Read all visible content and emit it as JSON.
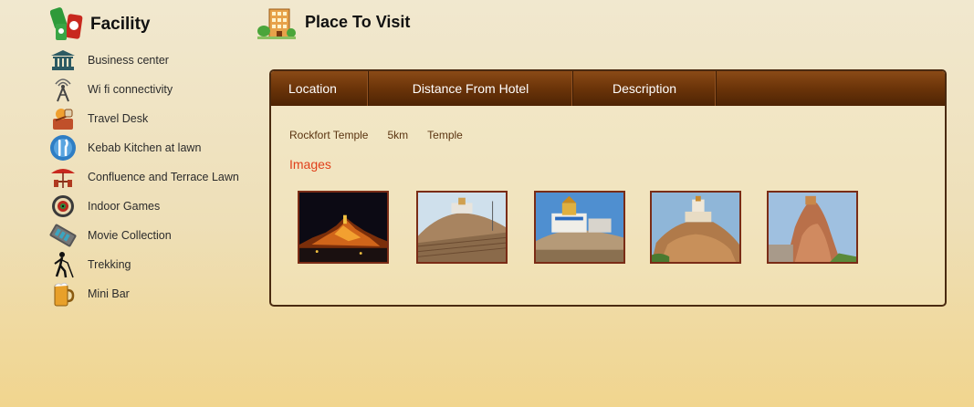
{
  "facility": {
    "title": "Facility",
    "items": [
      {
        "label": "Business center",
        "icon": "bank-building-icon"
      },
      {
        "label": "Wi fi connectivity",
        "icon": "wifi-tower-icon"
      },
      {
        "label": "Travel Desk",
        "icon": "travel-desk-icon"
      },
      {
        "label": "Kebab Kitchen at lawn",
        "icon": "fork-knife-icon"
      },
      {
        "label": "Confluence and Terrace Lawn",
        "icon": "terrace-umbrella-icon"
      },
      {
        "label": "Indoor Games",
        "icon": "dartboard-icon"
      },
      {
        "label": "Movie Collection",
        "icon": "film-reel-icon"
      },
      {
        "label": "Trekking",
        "icon": "hiker-icon"
      },
      {
        "label": "Mini Bar",
        "icon": "beer-mug-icon"
      }
    ]
  },
  "place": {
    "title": "Place To Visit",
    "tabs": {
      "location": "Location",
      "distance": "Distance From Hotel",
      "description": "Description"
    },
    "row": {
      "location": "Rockfort Temple",
      "distance": "5km",
      "description": "Temple"
    },
    "images_heading": "Images",
    "image_count": 5
  },
  "colors": {
    "tab_bar": "#6b3409",
    "images_heading": "#e0401b",
    "thumb_border": "#7a2c16"
  }
}
